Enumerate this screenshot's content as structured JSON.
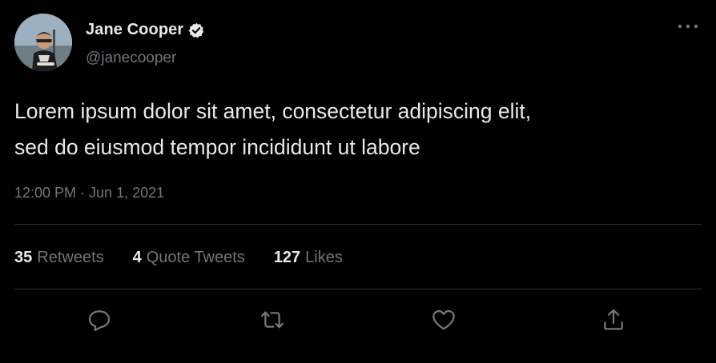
{
  "colors": {
    "background": "#000000",
    "primary_text": "#e7e9ea",
    "secondary_text": "#71767b",
    "divider": "#2f3336"
  },
  "author": {
    "display_name": "Jane Cooper",
    "handle": "@janecooper",
    "verified": true,
    "verified_icon": "verified-badge-icon"
  },
  "more_icon": "more-horizontal-icon",
  "tweet": {
    "text": "Lorem ipsum dolor sit amet, consectetur adipiscing elit,\nsed do eiusmod tempor incididunt ut labore",
    "time": "12:00 PM",
    "separator": "·",
    "date": "Jun 1, 2021"
  },
  "stats": [
    {
      "count": "35",
      "label": "Retweets"
    },
    {
      "count": "4",
      "label": "Quote Tweets"
    },
    {
      "count": "127",
      "label": "Likes"
    }
  ],
  "actions": [
    {
      "name": "reply",
      "icon": "reply-icon"
    },
    {
      "name": "retweet",
      "icon": "retweet-icon"
    },
    {
      "name": "like",
      "icon": "heart-icon"
    },
    {
      "name": "share",
      "icon": "share-icon"
    }
  ]
}
